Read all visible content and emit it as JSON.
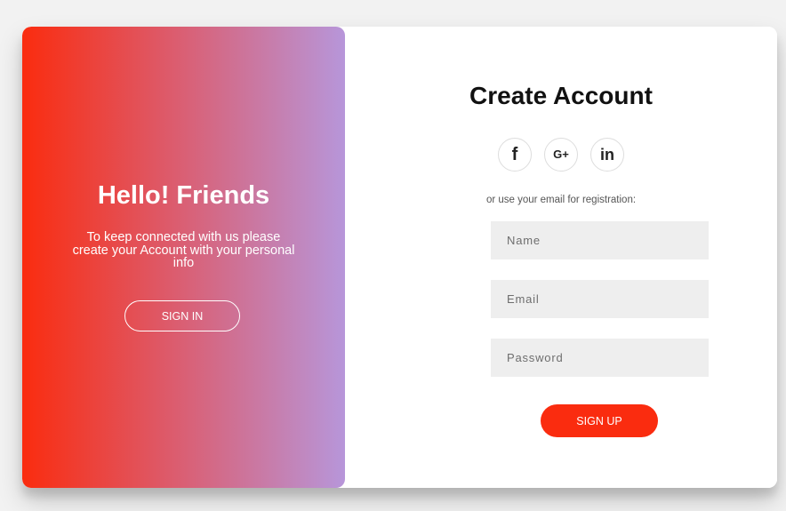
{
  "overlay": {
    "title": "Hello! Friends",
    "text": "To keep connected with us please create your Account with your personal info",
    "signin_label": "SIGN IN"
  },
  "form": {
    "title": "Create Account",
    "socials": [
      {
        "label": "f",
        "icon": "facebook-icon"
      },
      {
        "label": "G+",
        "icon": "google-plus-icon"
      },
      {
        "label": "in",
        "icon": "linkedin-icon"
      }
    ],
    "hint": "or use your email for registration:",
    "fields": {
      "name_placeholder": "Name",
      "email_placeholder": "Email",
      "password_placeholder": "Password"
    },
    "signup_label": "SIGN UP"
  },
  "colors": {
    "accent": "#fa2c0f",
    "gradient_end": "#b796da",
    "input_bg": "#eeeeee"
  }
}
